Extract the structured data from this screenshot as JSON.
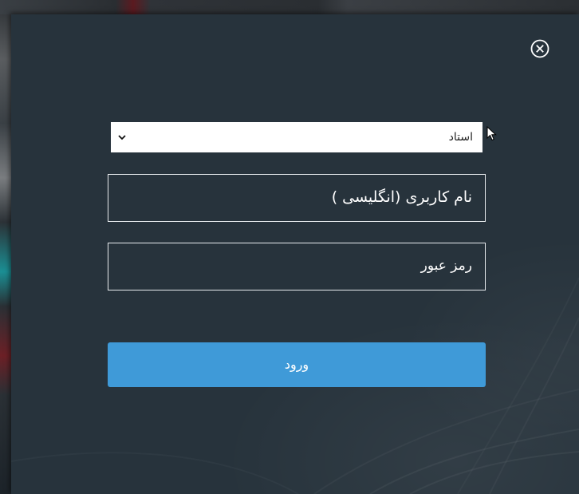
{
  "dialog": {
    "close_icon": "circle-x-icon",
    "role_select": {
      "selected": "استاد",
      "chevron_icon": "chevron-down-icon"
    },
    "username": {
      "placeholder": "نام کاربری (انگلیسی )"
    },
    "password": {
      "placeholder": "رمز عبور"
    },
    "login_button": {
      "label": "ورود"
    }
  },
  "colors": {
    "modal_background": "#27333c",
    "field_border": "#e8ecef",
    "button_background": "#3f9ad8",
    "text": "#ffffff"
  }
}
